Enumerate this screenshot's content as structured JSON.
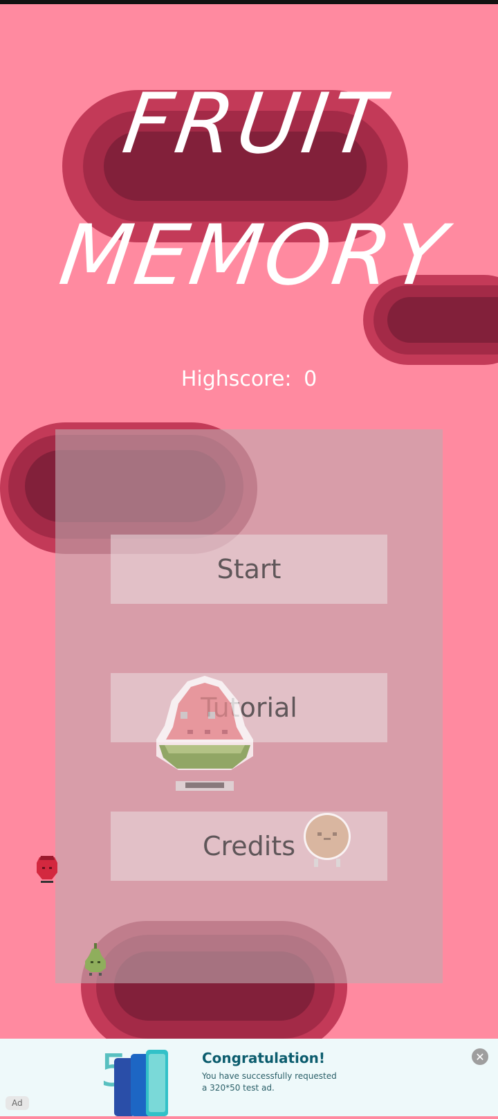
{
  "game": {
    "title_line1": "FRUIT",
    "title_line2": "MEMORY",
    "highscore_label": "Highscore:",
    "highscore_value": "0"
  },
  "menu": {
    "start_label": "Start",
    "tutorial_label": "Tutorial",
    "credits_label": "Credits"
  },
  "ad": {
    "title": "Congratulation!",
    "body": "You have successfully requested a 320*50 test ad.",
    "badge": "Ad",
    "close_icon": "close-icon"
  },
  "colors": {
    "background": "#ff8aa0",
    "blob_outer": "#c33a58",
    "blob_mid": "#a32a47",
    "blob_inner": "#82203a",
    "panel": "#beaaaf",
    "button_text": "#5f5659"
  },
  "sprites": [
    "watermelon-icon",
    "coconut-icon",
    "strawberry-icon",
    "pear-icon"
  ]
}
